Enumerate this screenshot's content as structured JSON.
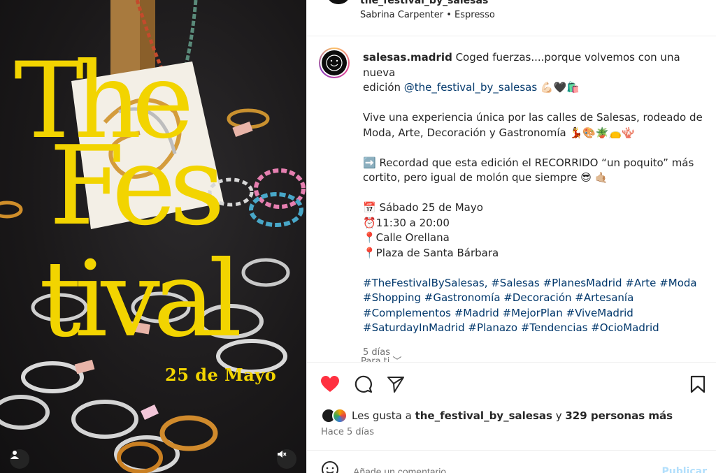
{
  "post": {
    "header_handle": "the_festival_by_salesas",
    "header_sub": "Sabrina Carpenter • Espresso",
    "author": "salesas.madrid",
    "caption_lines": {
      "l1_rest": " Coged fuerzas....porque volvemos con una nueva",
      "l2_pre": "edición ",
      "l2_mention": "@the_festival_by_salesas",
      "l2_emoji": " 💪🏻🖤🛍️",
      "p2a": "Vive una experiencia única por las calles de Salesas, rodeado de",
      "p2b": "Moda, Arte, Decoración y Gastronomía 💃🎨🪴👝🪸",
      "p3a": "➡️ Recordad que esta edición el RECORRIDO “un poquito” más",
      "p3b": "cortito, pero igual de molón que siempre 😎 🤙🏼",
      "d1": "📅 Sábado 25 de Mayo",
      "d2": "⏰11:30 a 20:00",
      "d3": "📍Calle Orellana",
      "d4": "📍Plaza de Santa Bárbara",
      "h1": "#TheFestivalBySalesas, #Salesas #PlanesMadrid #Arte #Moda",
      "h2": "#Shopping #Gastronomía #Decoración #Artesanía",
      "h3": "#Complementos #Madrid #MejorPlan #ViveMadrid",
      "h4": "#SaturdayInMadrid #Planazo #Tendencias #OcioMadrid"
    },
    "caption_age": "5 días",
    "para_ti": "Para ti ﹀",
    "likes_prefix": "Les gusta a ",
    "likes_user": "the_festival_by_salesas",
    "likes_mid": " y ",
    "likes_count": "329 personas más",
    "posted_ago": "Hace 5 días",
    "comment_placeholder": "Añade un comentario...",
    "publish_label": "Publicar",
    "liked": true
  },
  "poster": {
    "line1": "The",
    "line2": "Fes",
    "line3": "tival",
    "date": "25 de Mayo",
    "accent": "#f2d400"
  },
  "icons": {
    "like": "heart-icon",
    "comment": "comment-icon",
    "share": "paper-plane-icon",
    "save": "bookmark-icon",
    "emoji": "smiley-icon",
    "mute": "speaker-muted-icon",
    "user_tag": "user-tag-icon"
  },
  "colors": {
    "like_red": "#ff3040",
    "link_blue": "#00376b",
    "publish_blue": "#b2dffc"
  }
}
